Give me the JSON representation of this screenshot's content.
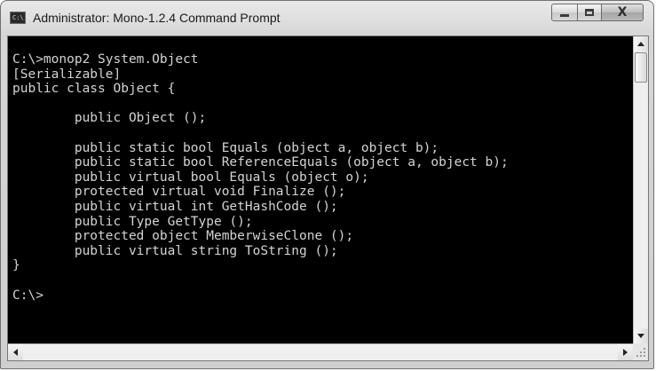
{
  "window": {
    "title": "Administrator: Mono-1.2.4 Command Prompt",
    "icon_label": "C:\\",
    "icon": "console-window-icon",
    "controls": {
      "minimize": "minimize-icon",
      "maximize": "maximize-icon",
      "close_glyph": "X"
    }
  },
  "console": {
    "background": "#000000",
    "foreground": "#d4d4d4",
    "lines": [
      "C:\\>monop2 System.Object",
      "[Serializable]",
      "public class Object {",
      "",
      "        public Object ();",
      "",
      "        public static bool Equals (object a, object b);",
      "        public static bool ReferenceEquals (object a, object b);",
      "        public virtual bool Equals (object o);",
      "        protected virtual void Finalize ();",
      "        public virtual int GetHashCode ();",
      "        public Type GetType ();",
      "        protected object MemberwiseClone ();",
      "        public virtual string ToString ();",
      "}",
      "",
      "C:\\>"
    ]
  },
  "scrollbars": {
    "vertical_position": 0,
    "horizontal_position": 0
  }
}
